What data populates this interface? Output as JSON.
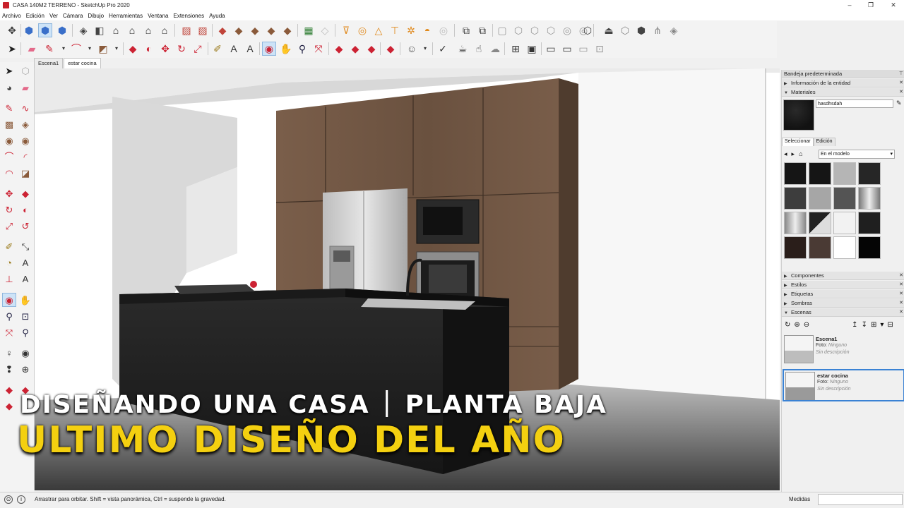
{
  "window": {
    "title": "CASA 140M2 TERRENO - SketchUp Pro 2020",
    "minimize": "–",
    "restore": "❐",
    "close": "✕"
  },
  "menu": [
    "Archivo",
    "Edición",
    "Ver",
    "Cámara",
    "Dibujo",
    "Herramientas",
    "Ventana",
    "Extensiones",
    "Ayuda"
  ],
  "scene_tabs": [
    "Escena1",
    "estar cocina"
  ],
  "active_scene_tab": 1,
  "overlay": {
    "line1_left": "DISEÑANDO UNA CASA",
    "line1_right": "PLANTA BAJA",
    "line2": "ULTIMO DISEÑO DEL AÑO",
    "color_line2": "#f4d010"
  },
  "tray": {
    "title": "Bandeja predeterminada",
    "panel_entity": "Información de la entidad",
    "panel_materials": "Materiales",
    "material_name": "hasdhsdah",
    "tab_select": "Seleccionar",
    "tab_edit": "Edición",
    "library": "En el modelo",
    "panel_components": "Componentes",
    "panel_styles": "Estilos",
    "panel_tags": "Etiquetas",
    "panel_shadows": "Sombras",
    "panel_scenes": "Escenas",
    "scenes": [
      {
        "name": "Escena1",
        "foto_label": "Foto:",
        "foto_value": "Ninguno",
        "desc": "Sin descripción"
      },
      {
        "name": "estar cocina",
        "foto_label": "Foto:",
        "foto_value": "Ninguno",
        "desc": "Sin descripción"
      }
    ]
  },
  "status": {
    "hint": "Arrastrar para orbitar. Shift = vista panorámica, Ctrl = suspende la gravedad.",
    "measure_label": "Medidas",
    "measure_value": ""
  },
  "toolbar_icons_row1": [
    "select-icon",
    "cube-icon",
    "cube-icon",
    "cube-icon",
    "cube-icon",
    "cube-icon",
    "home-icon",
    "home-icon",
    "home-icon",
    "home-icon",
    "layer-icon",
    "layer-icon",
    "sandbox-icon",
    "sandbox-icon",
    "sandbox-icon",
    "sandbox-icon",
    "sandbox-icon",
    "map-icon",
    "map-icon",
    "section-icon",
    "section-icon",
    "section-icon",
    "section-icon",
    "section-icon",
    "section-icon",
    "section-icon",
    "group-icon",
    "group-icon",
    "view-icon",
    "view-icon",
    "view-icon",
    "view-icon",
    "view-icon",
    "view-icon",
    "warehouse-icon",
    "warehouse-icon",
    "warehouse-icon",
    "warehouse-icon",
    "warehouse-icon"
  ],
  "toolbar_icons_row2": [
    "select-icon",
    "eraser-icon",
    "pencil-icon",
    "arc-icon",
    "rectangle-icon",
    "move-icon",
    "rotate-icon",
    "scale-icon",
    "pushpull-icon",
    "offset-icon",
    "tape-icon",
    "text-icon",
    "paint-icon",
    "orbit-icon",
    "pan-icon",
    "zoom-icon",
    "zoom-extents-icon",
    "ruby-icon",
    "ruby-icon",
    "ruby-icon",
    "ruby-icon",
    "user-icon",
    "check-icon",
    "teapot-icon",
    "cloud-icon"
  ],
  "colors": {
    "wood": "#6f5644",
    "counter": "#1b1b1b",
    "accent": "#3a82d4"
  }
}
